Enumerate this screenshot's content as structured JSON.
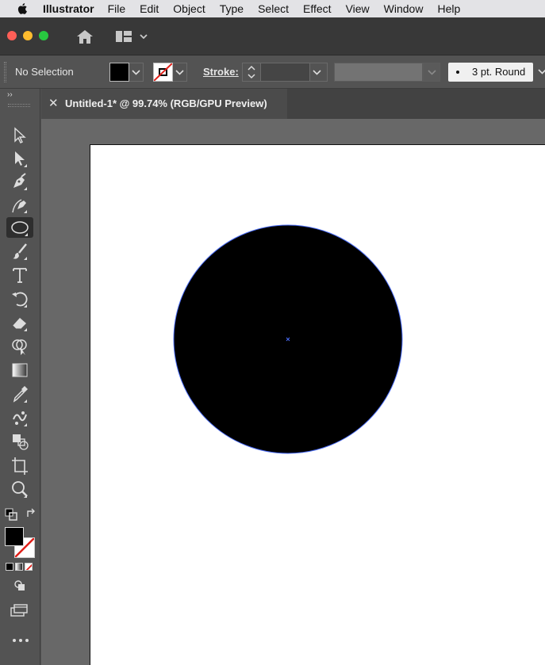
{
  "menubar": {
    "apple_icon": "apple-icon",
    "app_name": "Illustrator",
    "items": [
      "File",
      "Edit",
      "Object",
      "Type",
      "Select",
      "Effect",
      "View",
      "Window",
      "Help"
    ]
  },
  "titlebar": {
    "icons": [
      "home-icon",
      "workspace-switcher-icon"
    ]
  },
  "control_bar": {
    "selection_label": "No Selection",
    "fill_color": "#000000",
    "stroke_color": "none",
    "stroke_label": "Stroke:",
    "stroke_weight": "",
    "brush_definition": "3 pt. Round"
  },
  "document": {
    "tab_title": "Untitled-1* @ 99.74% (RGB/GPU Preview)",
    "zoom": "99.74%",
    "color_mode": "RGB/GPU Preview"
  },
  "toolbar": {
    "tools": [
      "selection-tool",
      "direct-selection-tool",
      "pen-tool",
      "curvature-tool",
      "ellipse-tool",
      "paintbrush-tool",
      "type-tool",
      "rotate-tool",
      "eraser-tool",
      "shape-builder-tool",
      "gradient-tool",
      "eyedropper-tool",
      "blend-tool",
      "symbol-sprayer-tool",
      "artboard-tool",
      "zoom-tool"
    ],
    "active_tool": "ellipse-tool"
  },
  "artwork": {
    "shape": "circle",
    "fill": "#000000",
    "selection_color": "#4a6cf7"
  }
}
